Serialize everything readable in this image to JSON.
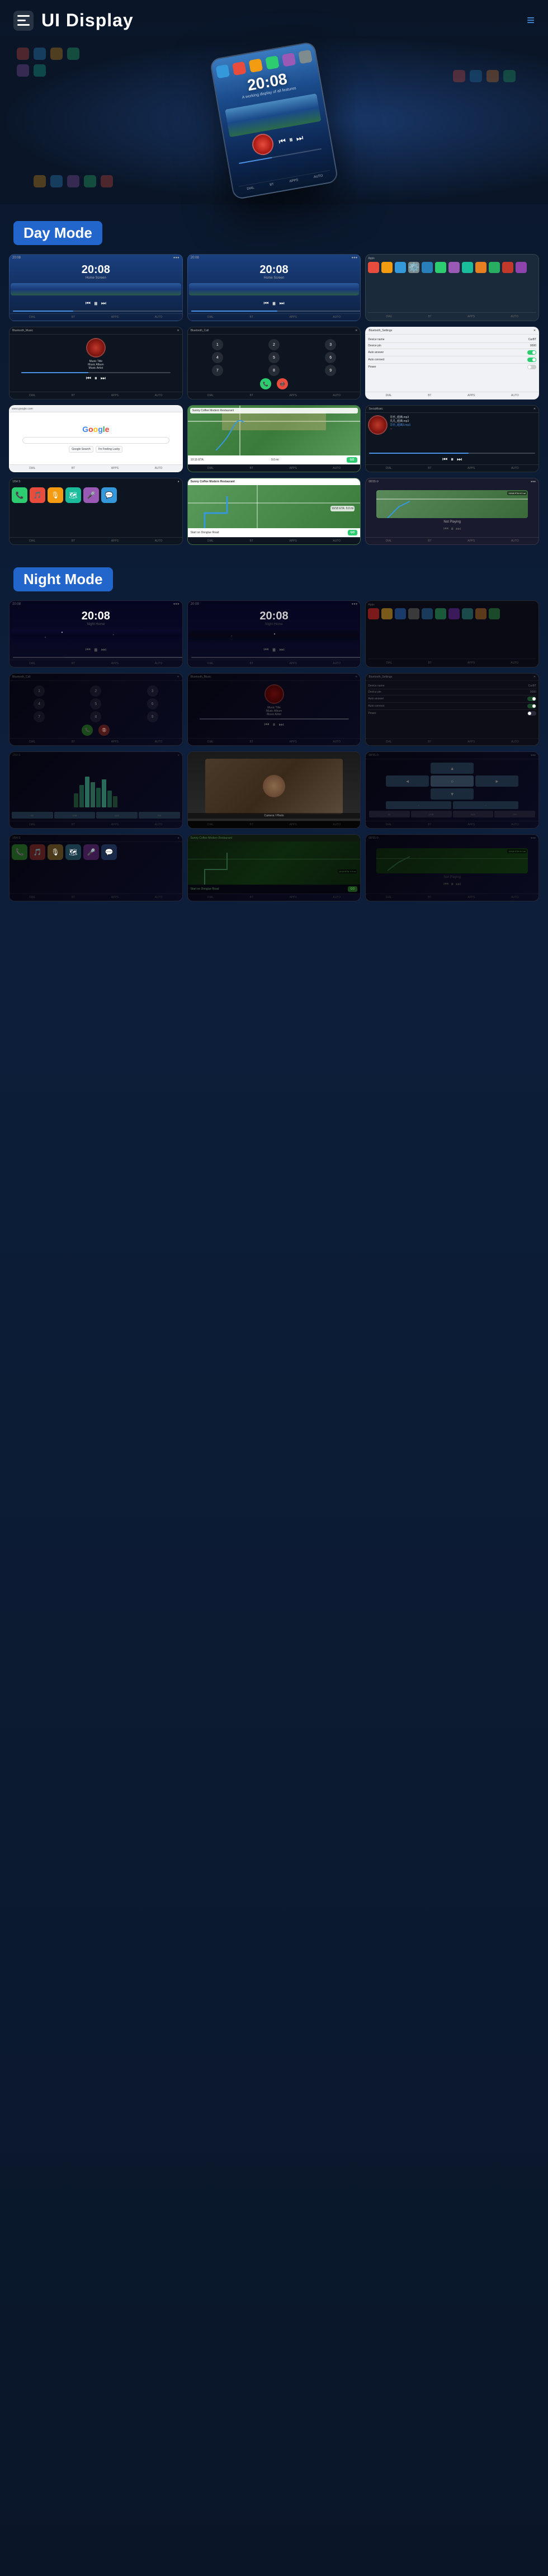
{
  "app": {
    "title": "UI Display",
    "menu_icon": "☰",
    "nav_icon": "≡"
  },
  "sections": {
    "day_mode": "Day Mode",
    "night_mode": "Night Mode"
  },
  "hero": {
    "time": "20:08",
    "subtitle": "A working display of all features"
  },
  "day_screens": {
    "home1": {
      "time": "20:08",
      "subtitle": "Home Screen 1"
    },
    "home2": {
      "time": "20:08",
      "subtitle": "Home Screen 2"
    },
    "music_title": "Music Title",
    "music_album": "Music Album",
    "music_artist": "Music Artist",
    "bluetooth_music": "Bluetooth_Music",
    "bluetooth_call": "Bluetooth_Call",
    "bluetooth_settings": "Bluetooth_Settings",
    "device_name_label": "Device name",
    "device_name_value": "CarBT",
    "device_pin_label": "Device pin",
    "device_pin_value": "0000",
    "auto_answer_label": "Auto answer",
    "auto_connect_label": "Auto connect",
    "power_label": "Power",
    "social_music": "SociaMusic"
  },
  "night_screens": {
    "home1": {
      "time": "20:08",
      "subtitle": "Night Home 1"
    },
    "home2": {
      "time": "20:08",
      "subtitle": "Night Home 2"
    },
    "bluetooth_call": "Bluetooth_Call",
    "bluetooth_music": "Bluetooth_Music",
    "bluetooth_settings": "Bluetooth_Settings",
    "device_name_label": "Device name",
    "device_name_value": "CarBT",
    "device_pin_label": "Device pin",
    "device_pin_value": "0000",
    "auto_answer_label": "Auto answer",
    "auto_connect_label": "Auto connect",
    "power_label": "Power"
  },
  "music": {
    "title": "Music Title",
    "album": "Music Album",
    "artist": "Music Artist"
  },
  "map": {
    "restaurant": "Sunny Coffee Modern Restaurant",
    "eta_label": "10:15 ETA",
    "distance": "9.0 mi",
    "go_button": "GO",
    "direction": "Start on Donglue Road",
    "navi_road": "Donglue Road"
  },
  "nav_items": [
    "DIAL",
    "BT",
    "APPS",
    "AUTO"
  ],
  "app_colors": {
    "phone": "#2ecc71",
    "messages": "#27ae60",
    "music": "#e74c3c",
    "maps": "#3498db",
    "settings": "#7f8c8d",
    "bluetooth": "#2980b9",
    "tel": "#f39c12",
    "navi": "#1abc9c",
    "camera": "#9b59b6",
    "radio": "#e67e22",
    "youtube": "#e74c3c",
    "netflix": "#e74c3c",
    "podcast": "#9b59b6"
  }
}
